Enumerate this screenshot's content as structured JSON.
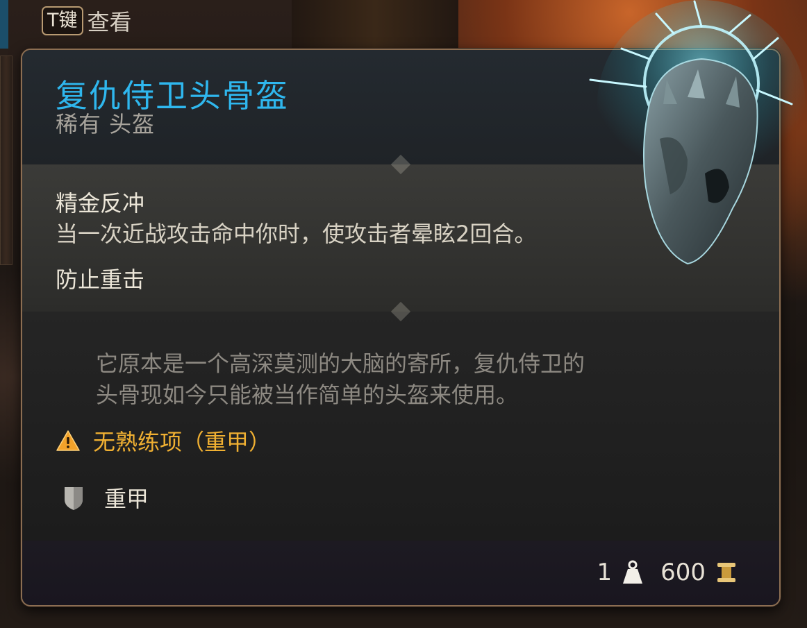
{
  "hint": {
    "key": "T键",
    "label": "查看"
  },
  "item": {
    "name": "复仇侍卫头骨盔",
    "rarity_type": "稀有 头盔",
    "properties": [
      {
        "name": "精金反冲",
        "desc": "当一次近战攻击命中你时，使攻击者晕眩2回合。"
      },
      {
        "name": "防止重击"
      }
    ],
    "flavor_line1": "它原本是一个高深莫测的大脑的寄所，复仇侍卫的",
    "flavor_line2": "头骨现如今只能被当作简单的头盔来使用。",
    "warning": "无熟练项（重甲）",
    "armor_type": "重甲",
    "weight": "1",
    "value": "600"
  },
  "icons": {
    "warning": "warning-triangle-icon",
    "armor": "shield-icon",
    "weight": "weight-icon",
    "gold": "gold-coin-icon"
  },
  "colors": {
    "title": "#2fb7ee",
    "warning": "#f0b032",
    "panel_border": "#8c6e52"
  }
}
